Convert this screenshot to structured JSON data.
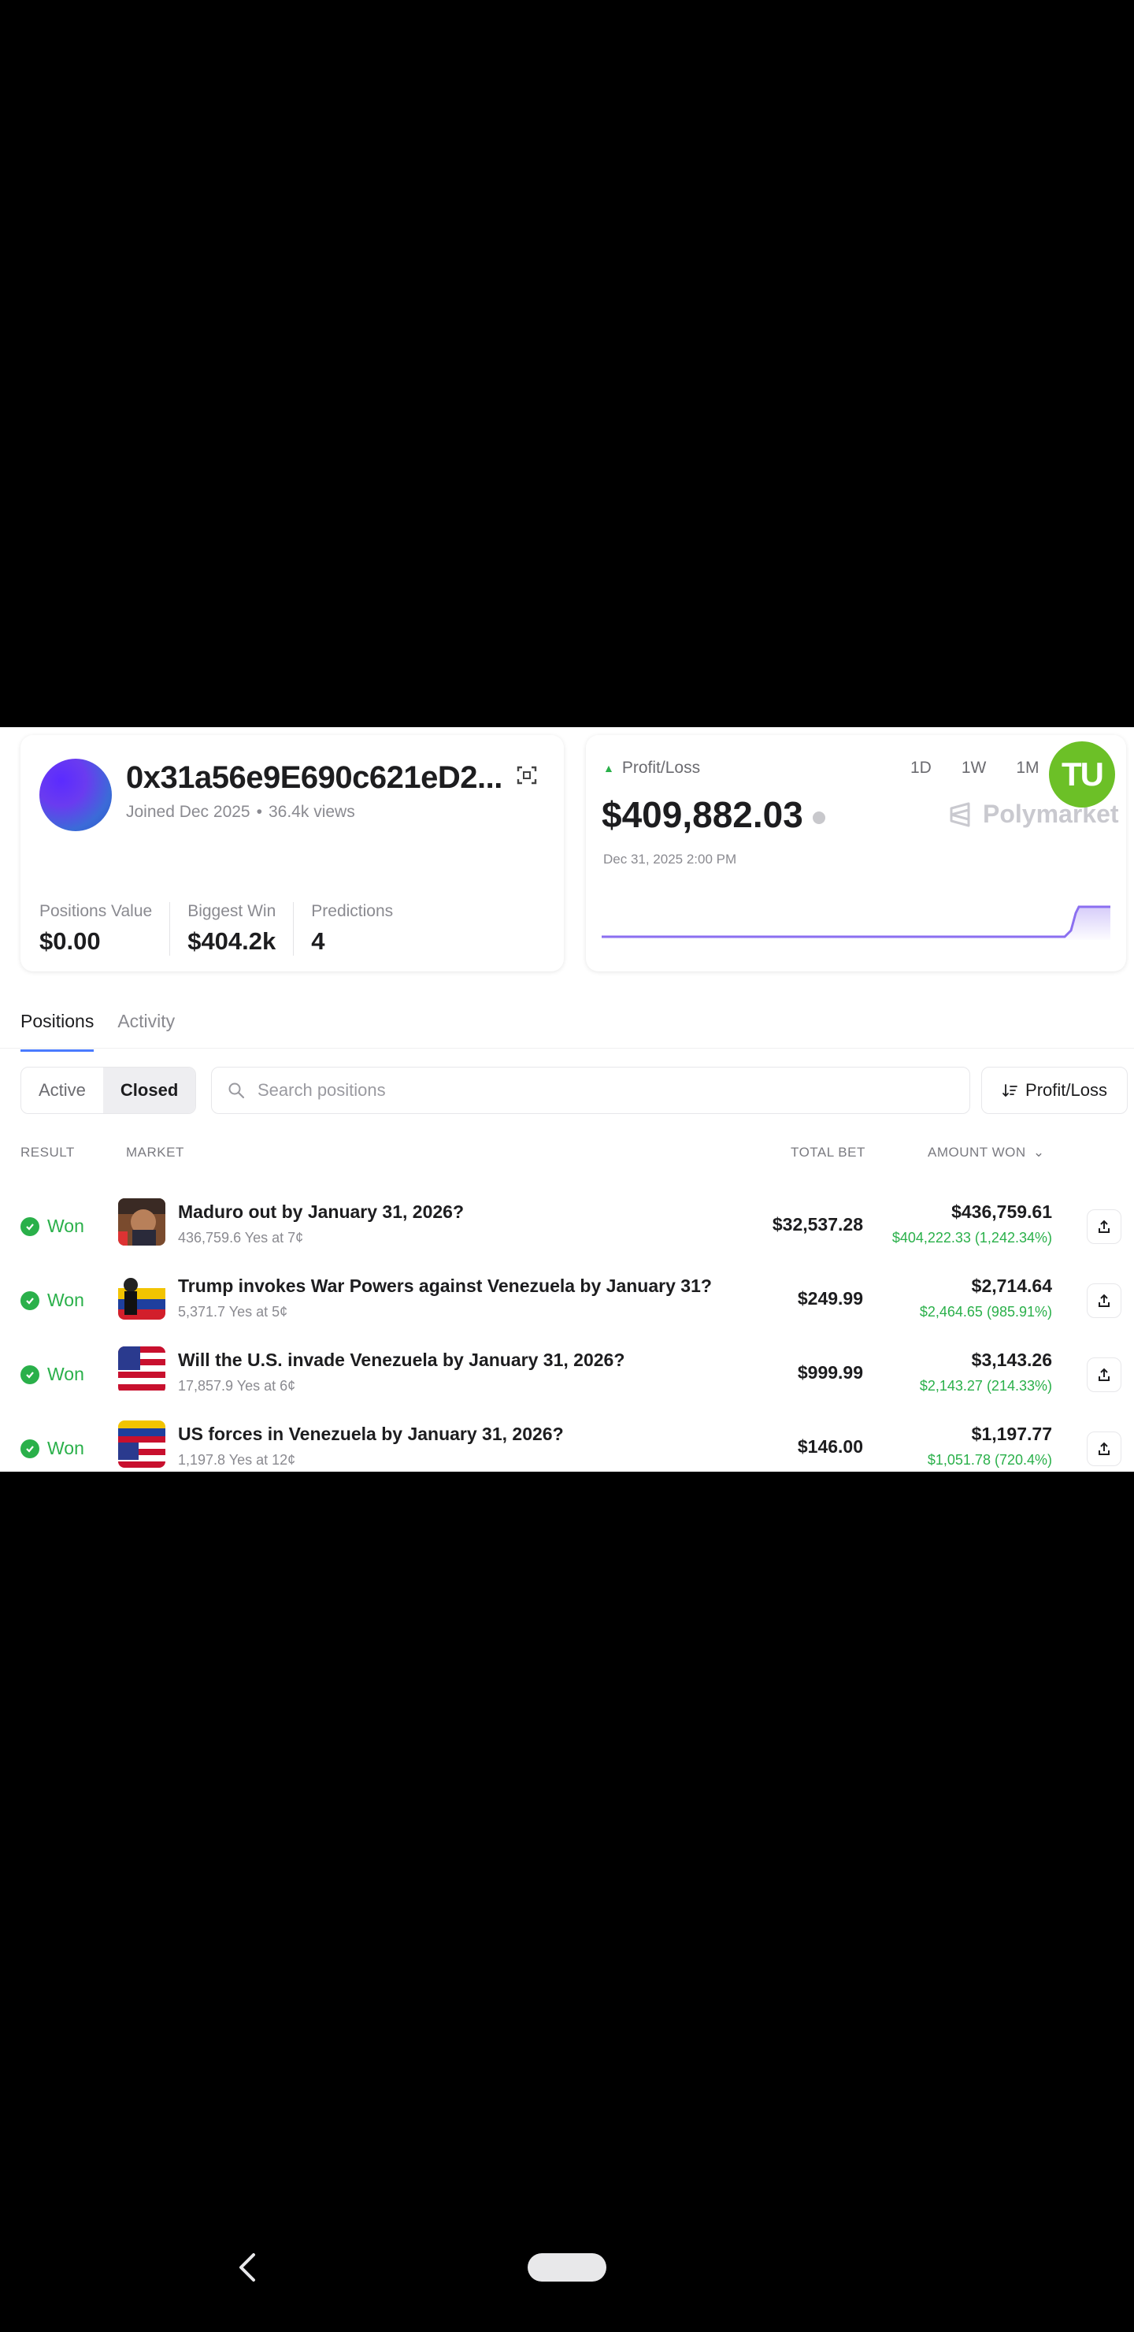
{
  "profile": {
    "address": "0x31a56e9E690c621eD2...",
    "joined": "Joined Dec 2025",
    "views": "36.4k views",
    "stats": [
      {
        "label": "Positions Value",
        "value": "$0.00"
      },
      {
        "label": "Biggest Win",
        "value": "$404.2k"
      },
      {
        "label": "Predictions",
        "value": "4"
      }
    ]
  },
  "pnl": {
    "label": "Profit/Loss",
    "value": "$409,882.03",
    "date": "Dec 31, 2025 2:00 PM",
    "ranges": [
      "1D",
      "1W",
      "1M"
    ],
    "brand": "Polymarket",
    "badge": "TU",
    "line_color": "#8b6ff0"
  },
  "tabs": [
    "Positions",
    "Activity"
  ],
  "filters": {
    "active": "Active",
    "closed": "Closed",
    "search_placeholder": "Search positions",
    "sort_label": "Profit/Loss"
  },
  "table": {
    "headers": {
      "result": "RESULT",
      "market": "MARKET",
      "total_bet": "TOTAL BET",
      "amount_won": "AMOUNT WON"
    },
    "rows": [
      {
        "result": "Won",
        "title": "Maduro out by January 31, 2026?",
        "sub": "436,759.6 Yes at 7¢",
        "bet": "$32,537.28",
        "won": "$436,759.61",
        "won_sub": "$404,222.33 (1,242.34%)",
        "thumb": "maduro-portrait"
      },
      {
        "result": "Won",
        "title": "Trump invokes War Powers against Venezuela by January 31?",
        "sub": "5,371.7 Yes at 5¢",
        "bet": "$249.99",
        "won": "$2,714.64",
        "won_sub": "$2,464.65 (985.91%)",
        "thumb": "venezuela-flag-figure"
      },
      {
        "result": "Won",
        "title": "Will the U.S. invade Venezuela by January 31, 2026?",
        "sub": "17,857.9 Yes at 6¢",
        "bet": "$999.99",
        "won": "$3,143.26",
        "won_sub": "$2,143.27 (214.33%)",
        "thumb": "us-flag"
      },
      {
        "result": "Won",
        "title": "US forces in Venezuela by January 31, 2026?",
        "sub": "1,197.8 Yes at 12¢",
        "bet": "$146.00",
        "won": "$1,197.77",
        "won_sub": "$1,051.78 (720.4%)",
        "thumb": "us-venezuela-flags"
      }
    ]
  },
  "colors": {
    "won_green": "#2ab04a",
    "tab_accent": "#4a7bff",
    "badge_green": "#6cc027"
  }
}
